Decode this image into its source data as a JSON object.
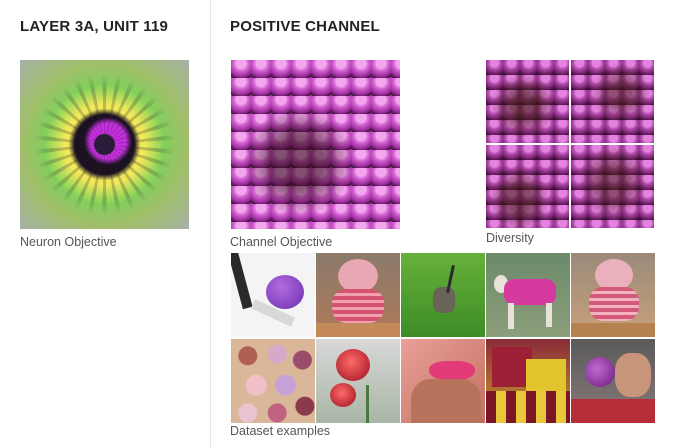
{
  "left": {
    "title": "LAYER 3A, UNIT 119",
    "neuron_caption": "Neuron Objective"
  },
  "right": {
    "title": "POSITIVE CHANNEL",
    "channel_caption": "Channel Objective",
    "diversity_caption": "Diversity",
    "dataset_caption": "Dataset examples"
  },
  "dataset_examples": [
    {
      "name": "dataset-example-pompom"
    },
    {
      "name": "dataset-example-pink-plush-toy"
    },
    {
      "name": "dataset-example-antelope-on-grass"
    },
    {
      "name": "dataset-example-dog-in-pink-sweater"
    },
    {
      "name": "dataset-example-pink-plush-toy-2"
    },
    {
      "name": "dataset-example-eyeshadow-palette"
    },
    {
      "name": "dataset-example-red-roses"
    },
    {
      "name": "dataset-example-pink-bikini"
    },
    {
      "name": "dataset-example-sports-crowd"
    },
    {
      "name": "dataset-example-person-with-microphone"
    }
  ],
  "colors": {
    "accent_magenta": "#b43fb0",
    "divider": "#e6e6e6",
    "heading": "#222222",
    "caption": "#555555"
  }
}
